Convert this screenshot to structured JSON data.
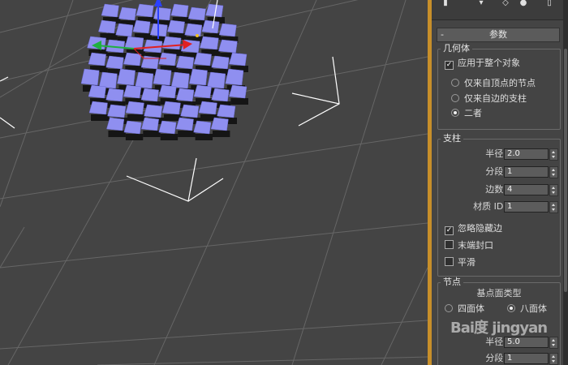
{
  "viewport": {
    "colors": {
      "background": "#444444",
      "grid": "#666666",
      "mesh_face": "#8f8ff0",
      "mesh_shadow": "#151515",
      "axis_x": "#e02020",
      "axis_y": "#20b040",
      "axis_z": "#2a40ff",
      "helper": "#ffffff",
      "gizmo_center": "#f0c020"
    }
  },
  "panel": {
    "toolbar_icons": [
      "pin-icon",
      "modifier-icon",
      "hierarchy-icon",
      "motion-icon",
      "display-icon"
    ],
    "rollout": {
      "toggle": "-",
      "title": "参数"
    },
    "geometry": {
      "title": "几何体",
      "apply_to_whole": {
        "label": "应用于整个对象",
        "checked": true
      },
      "options": [
        {
          "label": "仅来自顶点的节点",
          "selected": false
        },
        {
          "label": "仅来自边的支柱",
          "selected": false
        },
        {
          "label": "二者",
          "selected": true
        }
      ]
    },
    "struts": {
      "title": "支柱",
      "fields": [
        {
          "label": "半径:",
          "value": "2.0"
        },
        {
          "label": "分段:",
          "value": "1"
        },
        {
          "label": "边数:",
          "value": "4"
        },
        {
          "label": "材质 ID:",
          "value": "1"
        }
      ],
      "checks": [
        {
          "label": "忽略隐藏边",
          "checked": true
        },
        {
          "label": "末端封口",
          "checked": false
        },
        {
          "label": "平滑",
          "checked": false
        }
      ]
    },
    "joints": {
      "title": "节点",
      "base_type_label": "基点面类型",
      "types": [
        {
          "label": "四面体",
          "selected": false
        },
        {
          "label": "八面体",
          "selected": true
        }
      ],
      "fields": [
        {
          "label": "半径:",
          "value": "5.0"
        },
        {
          "label": "分段:",
          "value": "1"
        }
      ]
    },
    "accent": "#c78f2a"
  },
  "watermark": "Bai度 jingyan"
}
